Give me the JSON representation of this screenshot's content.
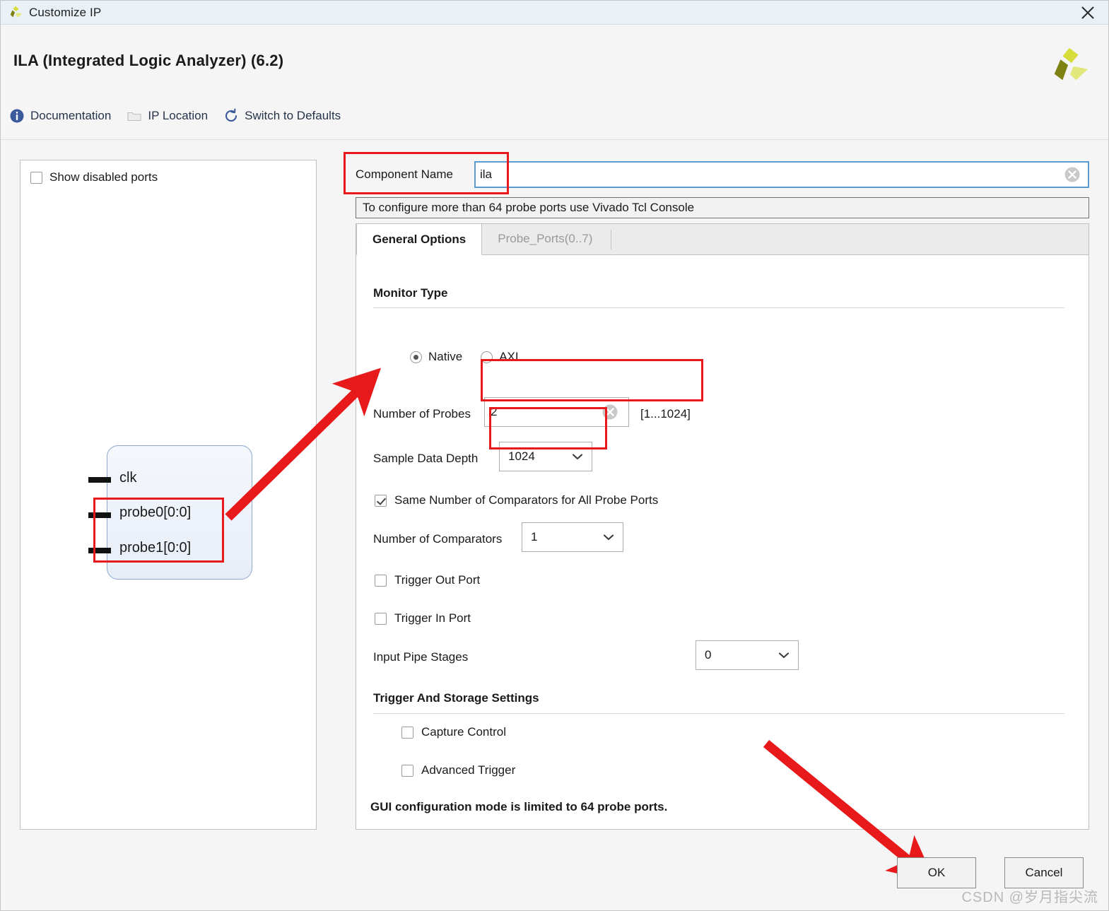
{
  "window": {
    "title": "Customize IP",
    "close_icon": "close-icon",
    "app_logo_icon": "xilinx-logo-icon"
  },
  "header": {
    "ip_title": "ILA (Integrated Logic Analyzer) (6.2)",
    "corner_logo_icon": "xilinx-logo-icon"
  },
  "toolbar": {
    "items": [
      {
        "label": "Documentation",
        "icon": "info-icon"
      },
      {
        "label": "IP Location",
        "icon": "folder-icon"
      },
      {
        "label": "Switch to Defaults",
        "icon": "refresh-icon"
      }
    ]
  },
  "left_panel": {
    "show_disabled_ports": {
      "label": "Show disabled ports",
      "checked": false
    },
    "symbol": {
      "ports": [
        "clk",
        "probe0[0:0]",
        "probe1[0:0]"
      ]
    }
  },
  "component": {
    "label": "Component Name",
    "value": "ila",
    "placeholder": "",
    "clear_icon": "clear-icon"
  },
  "info_bar": {
    "text": "To configure more than 64 probe ports use Vivado Tcl Console"
  },
  "tabs": [
    {
      "label": "General Options",
      "active": true
    },
    {
      "label": "Probe_Ports(0..7)",
      "active": false
    }
  ],
  "general_options": {
    "monitor_type": {
      "section_label": "Monitor Type",
      "options": [
        {
          "label": "Native",
          "selected": true
        },
        {
          "label": "AXI",
          "selected": false
        }
      ]
    },
    "number_of_probes": {
      "label": "Number of Probes",
      "value": "2",
      "range_hint": "[1...1024]",
      "clear_icon": "clear-icon"
    },
    "sample_data_depth": {
      "label": "Sample Data Depth",
      "value": "1024",
      "chevron_icon": "chevron-down-icon"
    },
    "same_comparators": {
      "label": "Same Number of Comparators for All Probe Ports",
      "checked": true
    },
    "number_of_comparators": {
      "label": "Number of Comparators",
      "value": "1",
      "chevron_icon": "chevron-down-icon"
    },
    "trigger_out_port": {
      "label": "Trigger Out Port",
      "checked": false
    },
    "trigger_in_port": {
      "label": "Trigger In Port",
      "checked": false
    },
    "input_pipe_stages": {
      "label": "Input Pipe Stages",
      "value": "0",
      "chevron_icon": "chevron-down-icon"
    },
    "trigger_storage": {
      "section_label": "Trigger And Storage Settings",
      "capture_control": {
        "label": "Capture Control",
        "checked": false
      },
      "advanced_trigger": {
        "label": "Advanced Trigger",
        "checked": false
      }
    },
    "note": "GUI configuration mode is limited to 64 probe ports."
  },
  "footer": {
    "ok_label": "OK",
    "cancel_label": "Cancel",
    "watermark": "CSDN @岁月指尖流"
  },
  "annotations": {
    "accent_color": "#e8191b"
  }
}
